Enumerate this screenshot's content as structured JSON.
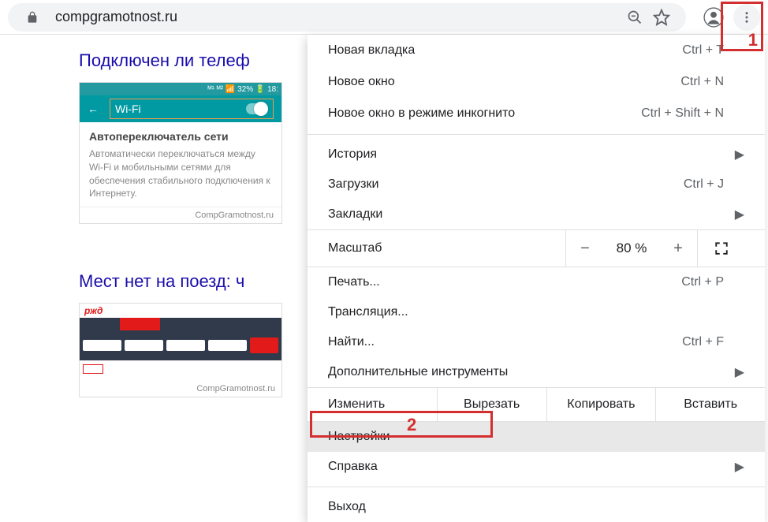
{
  "addressbar": {
    "url": "compgramotnost.ru"
  },
  "page": {
    "post1_title": "Подключен ли телеф",
    "wifi_card": {
      "status_icons": "ᴹ¹ ᴹ² 📶 32% 🔋 18:",
      "wifi_label": "Wi-Fi",
      "body_title": "Автопереключатель сети",
      "body_desc": "Автоматически переключаться между Wi-Fi и мобильными сетями для обеспечения стабильного подключения к Интернету.",
      "footer": "CompGramotnost.ru"
    },
    "post2_title": "Мест нет на поезд: ч",
    "rzd_logo": "ржд",
    "rzd_footer": "CompGramotnost.ru"
  },
  "menu": {
    "new_tab": "Новая вкладка",
    "new_tab_key": "Ctrl + T",
    "new_window": "Новое окно",
    "new_window_key": "Ctrl + N",
    "new_incognito": "Новое окно в режиме инкогнито",
    "new_incognito_key": "Ctrl + Shift + N",
    "history": "История",
    "downloads": "Загрузки",
    "downloads_key": "Ctrl + J",
    "bookmarks": "Закладки",
    "zoom_label": "Масштаб",
    "zoom_value": "80 %",
    "print": "Печать...",
    "print_key": "Ctrl + P",
    "cast": "Трансляция...",
    "find": "Найти...",
    "find_key": "Ctrl + F",
    "moretools": "Дополнительные инструменты",
    "edit_label": "Изменить",
    "cut": "Вырезать",
    "copy": "Копировать",
    "paste": "Вставить",
    "settings": "Настройки",
    "help": "Справка",
    "exit": "Выход"
  },
  "annot": {
    "one": "1",
    "two": "2"
  }
}
